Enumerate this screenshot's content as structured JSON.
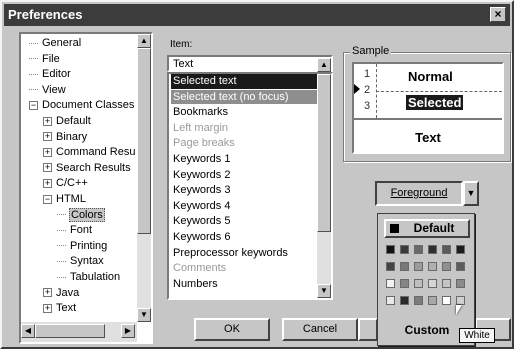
{
  "window": {
    "title": "Preferences",
    "close_glyph": "×"
  },
  "tree": {
    "items": [
      {
        "label": "General",
        "indent": 0,
        "expander": ""
      },
      {
        "label": "File",
        "indent": 0,
        "expander": ""
      },
      {
        "label": "Editor",
        "indent": 0,
        "expander": ""
      },
      {
        "label": "View",
        "indent": 0,
        "expander": ""
      },
      {
        "label": "Document Classes",
        "indent": 0,
        "expander": "−"
      },
      {
        "label": "Default",
        "indent": 1,
        "expander": "+"
      },
      {
        "label": "Binary",
        "indent": 1,
        "expander": "+"
      },
      {
        "label": "Command Resu",
        "indent": 1,
        "expander": "+"
      },
      {
        "label": "Search Results",
        "indent": 1,
        "expander": "+"
      },
      {
        "label": "C/C++",
        "indent": 1,
        "expander": "+"
      },
      {
        "label": "HTML",
        "indent": 1,
        "expander": "−"
      },
      {
        "label": "Colors",
        "indent": 2,
        "expander": "",
        "selected": true
      },
      {
        "label": "Font",
        "indent": 2,
        "expander": ""
      },
      {
        "label": "Printing",
        "indent": 2,
        "expander": ""
      },
      {
        "label": "Syntax",
        "indent": 2,
        "expander": ""
      },
      {
        "label": "Tabulation",
        "indent": 2,
        "expander": ""
      },
      {
        "label": "Java",
        "indent": 1,
        "expander": "+"
      },
      {
        "label": "Text",
        "indent": 1,
        "expander": "+"
      }
    ]
  },
  "items": {
    "label": "Item:",
    "current_value": "Text",
    "list": [
      {
        "label": "Selected text",
        "state": "selected"
      },
      {
        "label": "Selected text (no focus)",
        "state": "nofocus"
      },
      {
        "label": "Bookmarks",
        "state": ""
      },
      {
        "label": "Left margin",
        "state": "dim"
      },
      {
        "label": "Page breaks",
        "state": "dim"
      },
      {
        "label": "Keywords 1",
        "state": ""
      },
      {
        "label": "Keywords 2",
        "state": ""
      },
      {
        "label": "Keywords 3",
        "state": ""
      },
      {
        "label": "Keywords 4",
        "state": ""
      },
      {
        "label": "Keywords 5",
        "state": ""
      },
      {
        "label": "Keywords 6",
        "state": ""
      },
      {
        "label": "Preprocessor keywords",
        "state": ""
      },
      {
        "label": "Comments",
        "state": "dim"
      },
      {
        "label": "Numbers",
        "state": ""
      }
    ]
  },
  "sample": {
    "title": "Sample",
    "line_numbers": [
      "1",
      "2",
      "3"
    ],
    "normal_text": "Normal",
    "selected_text": "Selected",
    "text_sample": "Text"
  },
  "buttons": {
    "ok": "OK",
    "cancel": "Cancel"
  },
  "color_picker": {
    "dropdown_label": "Foreground",
    "default_label": "Default",
    "custom_label": "Custom",
    "tooltip": "White",
    "swatches": [
      "#111111",
      "#3a3a3a",
      "#6a6a6a",
      "#303030",
      "#5a5a5a",
      "#1c1c1c",
      "#444444",
      "#777777",
      "#9c9c9c",
      "#b0b0b0",
      "#909090",
      "#5c5c5c",
      "#f2f2f2",
      "#858585",
      "#bfbfbf",
      "#d6d6d6",
      "#c4c4c4",
      "#8a8a8a",
      "#e8e8e8",
      "#2a2a2a",
      "#7c7c7c",
      "#a8a8a8",
      "#ffffff",
      "#d0d0d0"
    ]
  }
}
